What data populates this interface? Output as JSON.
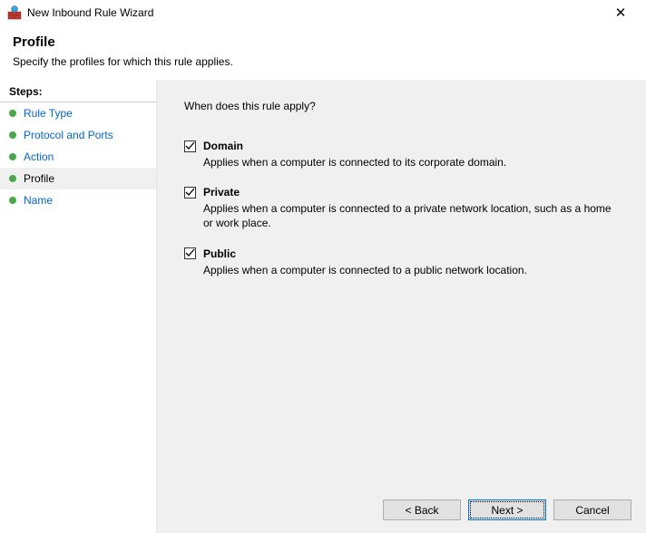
{
  "window": {
    "title": "New Inbound Rule Wizard"
  },
  "header": {
    "title": "Profile",
    "subtitle": "Specify the profiles for which this rule applies."
  },
  "sidebar": {
    "steps_label": "Steps:",
    "items": [
      {
        "label": "Rule Type",
        "state": "link"
      },
      {
        "label": "Protocol and Ports",
        "state": "link"
      },
      {
        "label": "Action",
        "state": "link"
      },
      {
        "label": "Profile",
        "state": "current"
      },
      {
        "label": "Name",
        "state": "link"
      }
    ]
  },
  "main": {
    "question": "When does this rule apply?",
    "options": [
      {
        "key": "domain",
        "label": "Domain",
        "checked": true,
        "desc": "Applies when a computer is connected to its corporate domain."
      },
      {
        "key": "private",
        "label": "Private",
        "checked": true,
        "desc": "Applies when a computer is connected to a private network location, such as a home or work place."
      },
      {
        "key": "public",
        "label": "Public",
        "checked": true,
        "desc": "Applies when a computer is connected to a public network location."
      }
    ]
  },
  "buttons": {
    "back": "< Back",
    "next": "Next >",
    "cancel": "Cancel"
  }
}
